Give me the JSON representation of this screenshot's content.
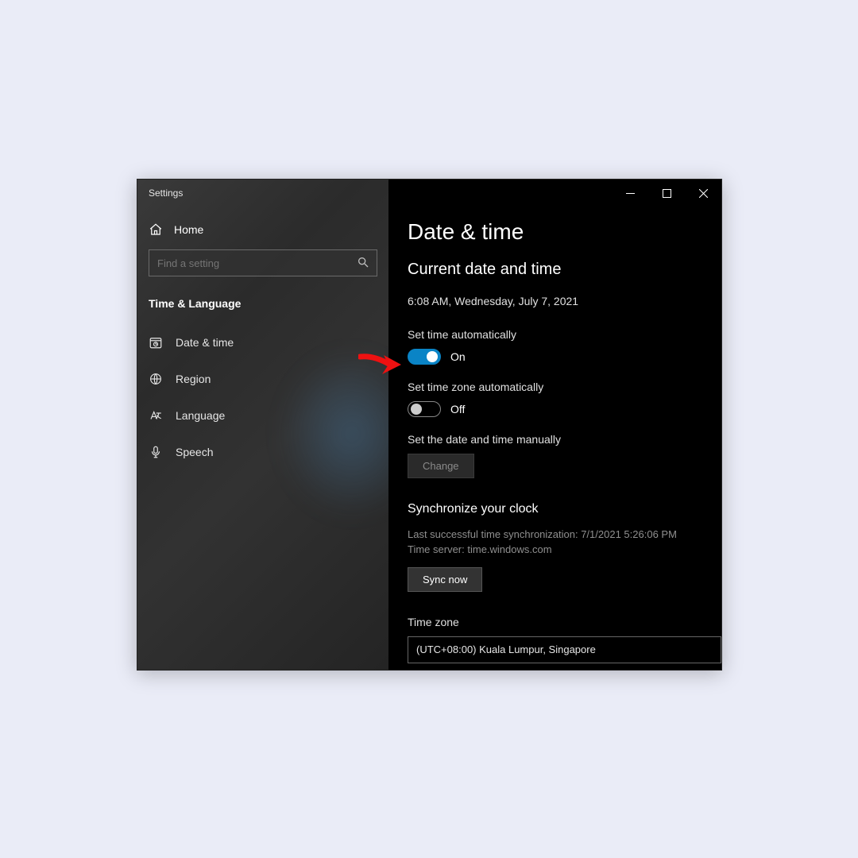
{
  "window": {
    "title": "Settings"
  },
  "sidebar": {
    "home": "Home",
    "search_placeholder": "Find a setting",
    "category": "Time & Language",
    "items": [
      {
        "label": "Date & time"
      },
      {
        "label": "Region"
      },
      {
        "label": "Language"
      },
      {
        "label": "Speech"
      }
    ]
  },
  "main": {
    "title": "Date & time",
    "subtitle": "Current date and time",
    "current_datetime": "6:08 AM, Wednesday, July 7, 2021",
    "set_time_auto": {
      "label": "Set time automatically",
      "state_text": "On"
    },
    "set_tz_auto": {
      "label": "Set time zone automatically",
      "state_text": "Off"
    },
    "set_manual": {
      "label": "Set the date and time manually",
      "button": "Change"
    },
    "sync": {
      "heading": "Synchronize your clock",
      "last": "Last successful time synchronization: 7/1/2021 5:26:06 PM",
      "server": "Time server: time.windows.com",
      "button": "Sync now"
    },
    "timezone": {
      "label": "Time zone",
      "value": "(UTC+08:00) Kuala Lumpur, Singapore"
    }
  }
}
